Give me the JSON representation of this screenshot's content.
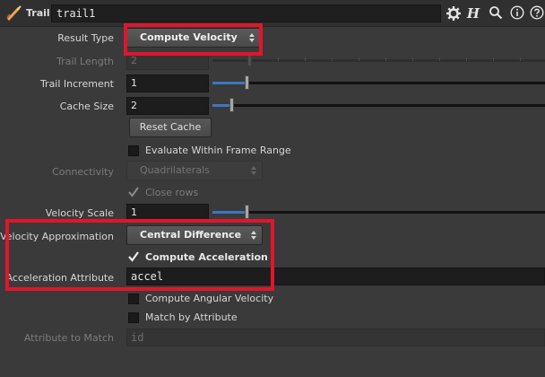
{
  "header": {
    "node_type": "Trail",
    "node_name": "trail1",
    "help_letter": "H",
    "icons": [
      "trail-tool-icon",
      "gear-icon",
      "help-h-icon",
      "search-icon",
      "info-icon",
      "question-icon"
    ]
  },
  "params": {
    "result_type": {
      "label": "Result Type",
      "value": "Compute Velocity"
    },
    "trail_length": {
      "label": "Trail Length",
      "value": "2"
    },
    "trail_increment": {
      "label": "Trail Increment",
      "value": "1"
    },
    "cache_size": {
      "label": "Cache Size",
      "value": "2"
    },
    "reset_cache": {
      "label": "Reset Cache"
    },
    "evaluate_within_range": {
      "label": "Evaluate Within Frame Range",
      "checked": false
    },
    "connectivity": {
      "label": "Connectivity",
      "value": "Quadrilaterals"
    },
    "close_rows": {
      "label": "Close rows",
      "checked": true
    },
    "velocity_scale": {
      "label": "Velocity Scale",
      "value": "1"
    },
    "velocity_approximation": {
      "label": "Velocity Approximation",
      "value": "Central Difference"
    },
    "compute_acceleration": {
      "label": "Compute Acceleration",
      "checked": true
    },
    "acceleration_attribute": {
      "label": "Acceleration Attribute",
      "value": "accel"
    },
    "compute_angular_velocity": {
      "label": "Compute Angular Velocity",
      "checked": false
    },
    "match_by_attribute": {
      "label": "Match by Attribute",
      "checked": false
    },
    "attribute_to_match": {
      "label": "Attribute to Match",
      "value": "id"
    }
  },
  "colors": {
    "highlight": "#e0162b",
    "slider_fill": "#3e76c0",
    "background": "#3a3a3a"
  }
}
